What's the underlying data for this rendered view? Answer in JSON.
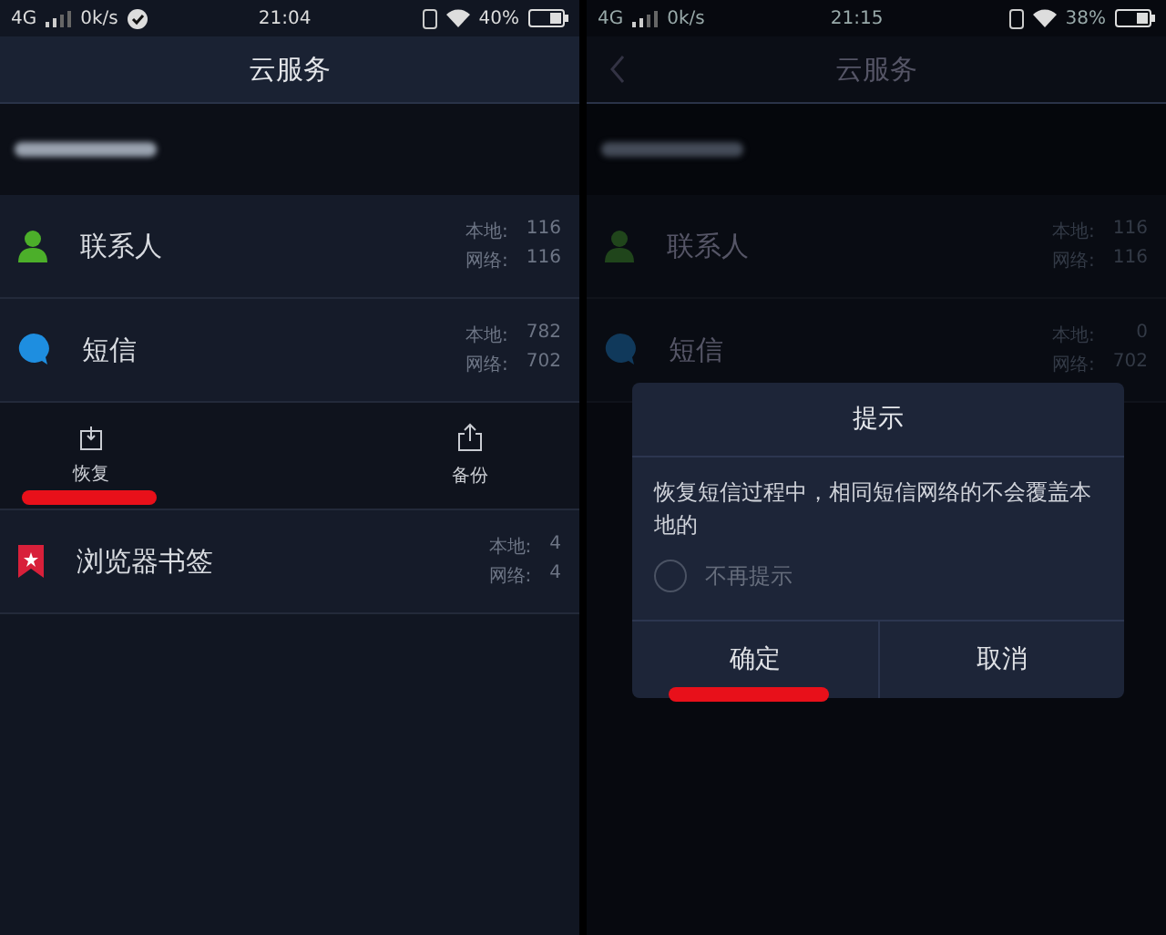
{
  "screens": [
    {
      "status_bar": {
        "network": "4G",
        "speed": "0k/s",
        "sync_badge": true,
        "time": "21:04",
        "battery": "40%"
      },
      "header": {
        "title": "云服务"
      },
      "sync_items": [
        {
          "kind": "contacts",
          "name": "联系人",
          "stats": [
            {
              "label": "本地:",
              "value": "116"
            },
            {
              "label": "网络:",
              "value": "116"
            }
          ]
        },
        {
          "kind": "sms",
          "name": "短信",
          "stats": [
            {
              "label": "本地:",
              "value": "782"
            },
            {
              "label": "网络:",
              "value": "702"
            }
          ],
          "actions": [
            {
              "kind": "restore",
              "label": "恢复",
              "highlighted": true
            },
            {
              "kind": "backup",
              "label": "备份",
              "highlighted": false
            }
          ]
        },
        {
          "kind": "bookmark",
          "name": "浏览器书签",
          "stats": [
            {
              "label": "本地:",
              "value": "4"
            },
            {
              "label": "网络:",
              "value": "4"
            }
          ]
        }
      ]
    },
    {
      "status_bar": {
        "network": "4G",
        "speed": "0k/s",
        "time": "21:15",
        "battery": "38%"
      },
      "header": {
        "title": "云服务",
        "back_button": true
      },
      "sync_items": [
        {
          "kind": "contacts",
          "name": "联系人",
          "stats": [
            {
              "label": "本地:",
              "value": "116"
            },
            {
              "label": "网络:",
              "value": "116"
            }
          ]
        },
        {
          "kind": "sms",
          "name": "短信",
          "stats": [
            {
              "label": "本地:",
              "value": "0"
            },
            {
              "label": "网络:",
              "value": "702"
            }
          ]
        }
      ],
      "dialog": {
        "title": "提示",
        "message": "恢复短信过程中，相同短信网络的不会覆盖本地的",
        "checkbox": {
          "label": "不再提示",
          "checked": false
        },
        "buttons": [
          {
            "label": "确定",
            "highlighted": true
          },
          {
            "label": "取消",
            "highlighted": false
          }
        ]
      }
    }
  ]
}
